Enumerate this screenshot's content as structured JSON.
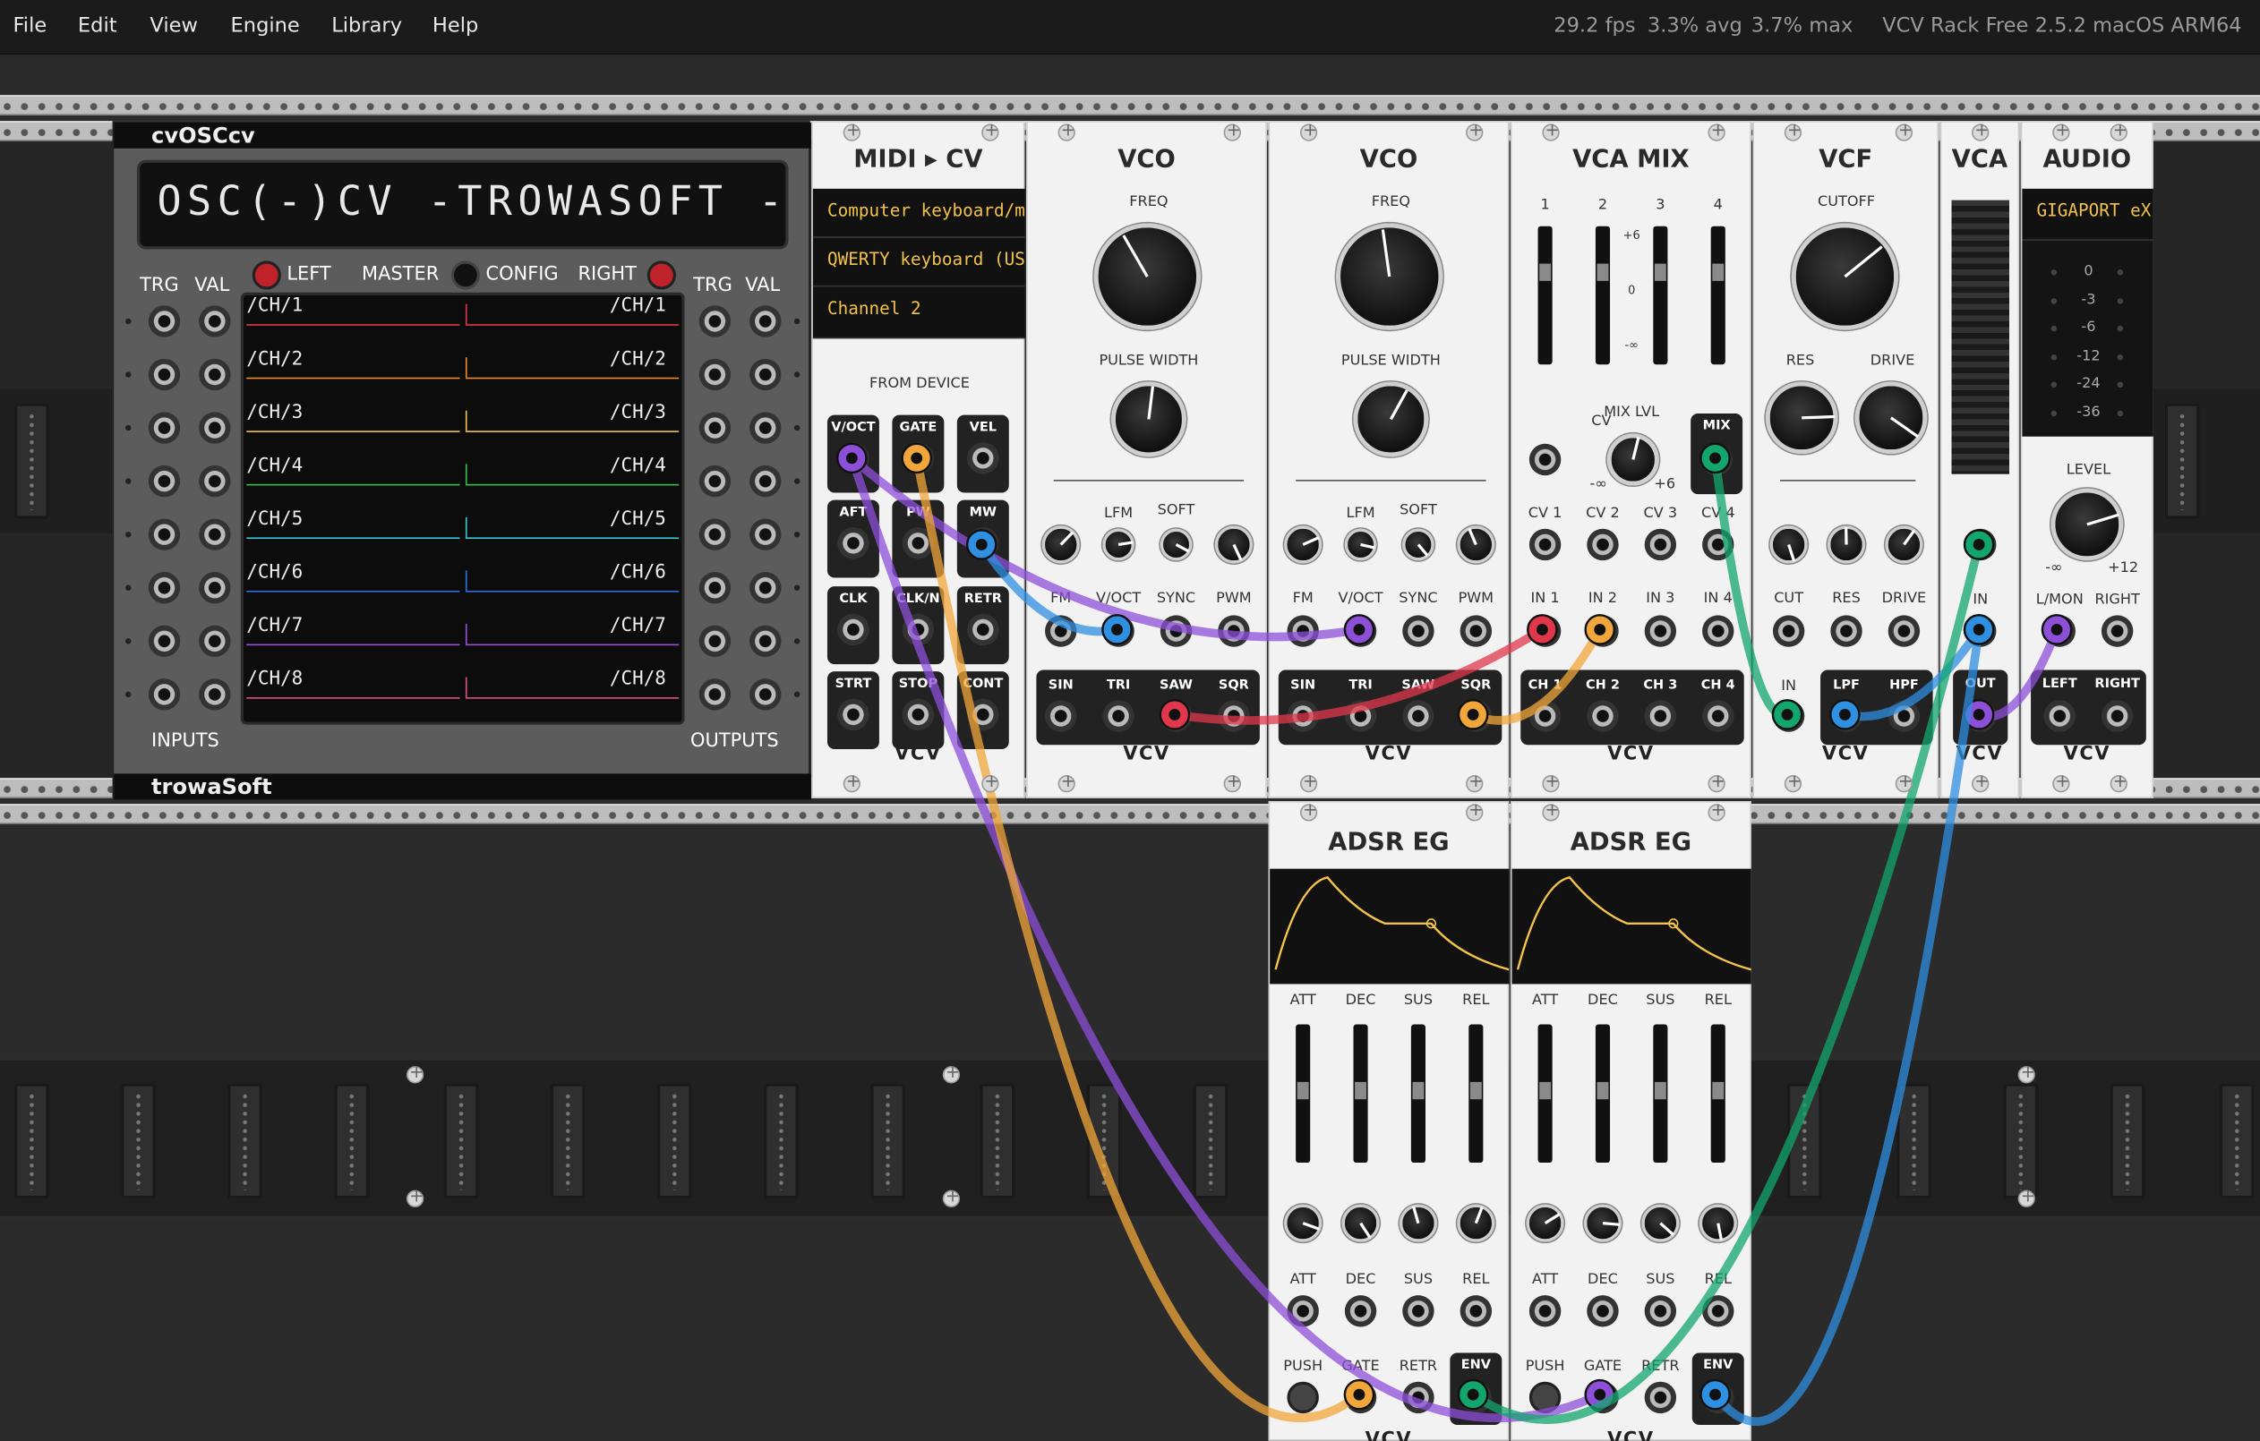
{
  "menu": {
    "items": [
      "File",
      "Edit",
      "View",
      "Engine",
      "Library",
      "Help"
    ]
  },
  "status": {
    "fps": "29.2 fps",
    "avg": "3.3% avg",
    "max": "3.7% max",
    "version": "VCV Rack Free 2.5.2 macOS ARM64"
  },
  "colors": {
    "purple": "#8e4fd8",
    "orange": "#f0a63a",
    "blue": "#2f8fe0",
    "green": "#13a56e",
    "red": "#e0374a",
    "yellow": "#f2c24a"
  },
  "osc": {
    "title": "cvOSCcv",
    "display": "OSC(-)CV -TROWASOFT -",
    "trg": "TRG",
    "val": "VAL",
    "left": "LEFT",
    "master": "MASTER",
    "config": "CONFIG",
    "right": "RIGHT",
    "inputs": "INPUTS",
    "outputs": "OUTPUTS",
    "footer": "trowaSoft",
    "channels": [
      "/CH/1",
      "/CH/2",
      "/CH/3",
      "/CH/4",
      "/CH/5",
      "/CH/6",
      "/CH/7",
      "/CH/8"
    ],
    "channel_colors": [
      "#e0374a",
      "#f08c2a",
      "#f2c24a",
      "#35c44a",
      "#38c8d8",
      "#2f6fe0",
      "#9b4fd8",
      "#e0508a"
    ]
  },
  "midi": {
    "title": "MIDI ▸ CV",
    "driver": "Computer keyboard/m",
    "device": "QWERTY keyboard (US",
    "channel": "Channel 2",
    "from_device": "FROM DEVICE",
    "jacks": [
      "V/OCT",
      "GATE",
      "VEL",
      "AFT",
      "PW",
      "MW",
      "CLK",
      "CLK/N",
      "RETR",
      "STRT",
      "STOP",
      "CONT"
    ],
    "logo": "VCV"
  },
  "vco1": {
    "title": "VCO",
    "freq": "FREQ",
    "pw": "PULSE WIDTH",
    "lfm": "LFM",
    "soft": "SOFT",
    "inputs": [
      "FM",
      "V/OCT",
      "SYNC",
      "PWM"
    ],
    "outputs": [
      "SIN",
      "TRI",
      "SAW",
      "SQR"
    ],
    "logo": "VCV"
  },
  "vco2": {
    "title": "VCO",
    "freq": "FREQ",
    "pw": "PULSE WIDTH",
    "lfm": "LFM",
    "soft": "SOFT",
    "inputs": [
      "FM",
      "V/OCT",
      "SYNC",
      "PWM"
    ],
    "outputs": [
      "SIN",
      "TRI",
      "SAW",
      "SQR"
    ],
    "logo": "VCV"
  },
  "vcamix": {
    "title": "VCA MIX",
    "channels": [
      "1",
      "2",
      "3",
      "4"
    ],
    "scale": [
      "+6",
      "0",
      "-∞"
    ],
    "cv": "CV",
    "mixlvl": "MIX LVL",
    "minf": "-∞",
    "plus6": "+6",
    "mix": "MIX",
    "cvs": [
      "CV 1",
      "CV 2",
      "CV 3",
      "CV 4"
    ],
    "ins": [
      "IN 1",
      "IN 2",
      "IN 3",
      "IN 4"
    ],
    "chs": [
      "CH 1",
      "CH 2",
      "CH 3",
      "CH 4"
    ],
    "logo": "VCV"
  },
  "vcf": {
    "title": "VCF",
    "cutoff": "CUTOFF",
    "res": "RES",
    "drive": "DRIVE",
    "inputs": [
      "CUT",
      "RES",
      "DRIVE"
    ],
    "outs": [
      "IN",
      "LPF",
      "HPF"
    ],
    "logo": "VCV"
  },
  "vca": {
    "title": "VCA",
    "in": "IN",
    "out": "OUT",
    "logo": "VCV"
  },
  "audio": {
    "title": "AUDIO",
    "device": "GIGAPORT eX",
    "meter": [
      "0",
      "-3",
      "-6",
      "-12",
      "-24",
      "-36"
    ],
    "level": "LEVEL",
    "minf": "-∞",
    "plus12": "+12",
    "lmon": "L/MON",
    "right": "RIGHT",
    "outs": [
      "LEFT",
      "RIGHT"
    ],
    "logo": "VCV"
  },
  "adsr1": {
    "title": "ADSR EG",
    "sliders": [
      "ATT",
      "DEC",
      "SUS",
      "REL"
    ],
    "cvs": [
      "ATT",
      "DEC",
      "SUS",
      "REL"
    ],
    "push": "PUSH",
    "gate": "GATE",
    "retr": "RETR",
    "env": "ENV",
    "logo": "VCV"
  },
  "adsr2": {
    "title": "ADSR EG",
    "sliders": [
      "ATT",
      "DEC",
      "SUS",
      "REL"
    ],
    "cvs": [
      "ATT",
      "DEC",
      "SUS",
      "REL"
    ],
    "push": "PUSH",
    "gate": "GATE",
    "retr": "RETR",
    "env": "ENV",
    "logo": "VCV"
  }
}
